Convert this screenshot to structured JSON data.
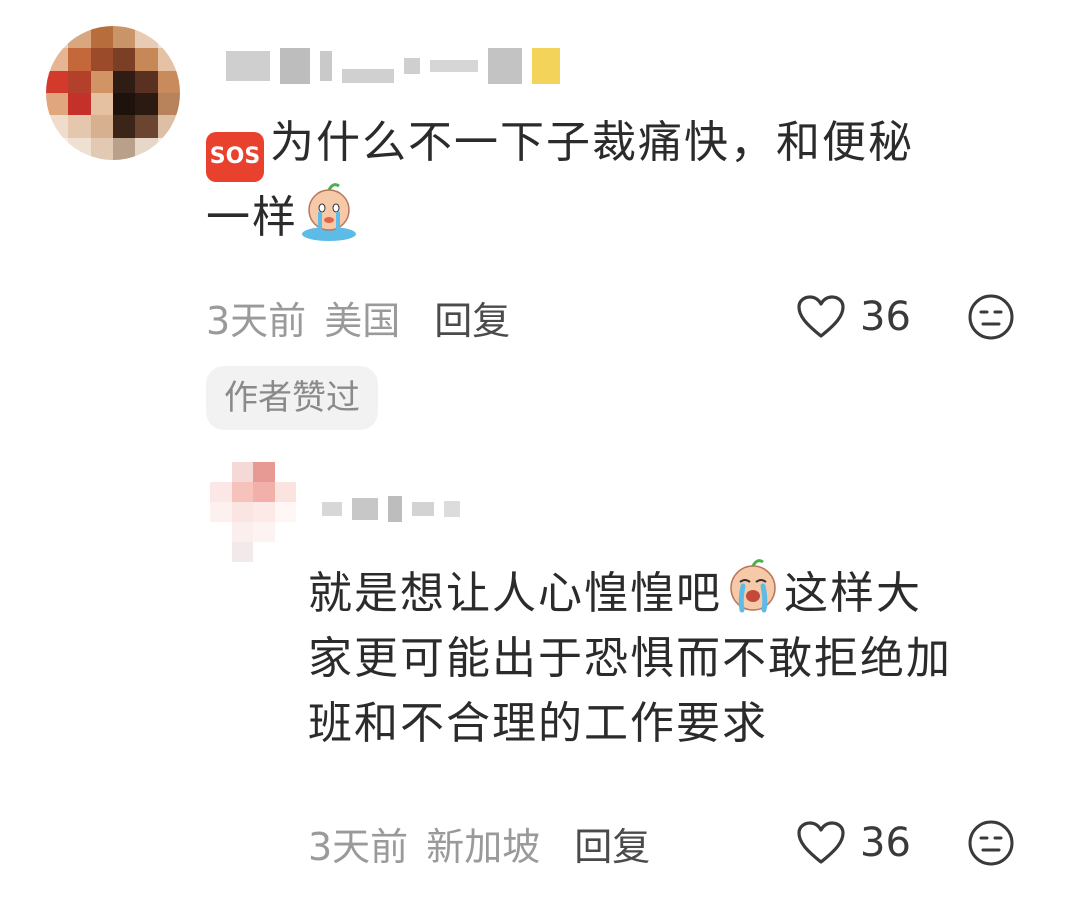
{
  "comments": [
    {
      "text_line1": "为什么不一下子裁痛快，和便秘",
      "text_line2": "一样",
      "time": "3天前",
      "region": "美国",
      "reply_label": "回复",
      "likes": "36",
      "badge": "作者赞过",
      "sos_label": "SOS",
      "emoji": "crying-face-emoji"
    },
    {
      "text_line1a": "就是想让人心惶惶吧",
      "text_line1b": "这样大",
      "text_line2": "家更可能出于恐惧而不敢拒绝加",
      "text_line3": "班和不合理的工作要求",
      "time": "3天前",
      "region": "新加坡",
      "reply_label": "回复",
      "likes": "36",
      "emoji": "sobbing-face-emoji"
    }
  ],
  "icons": {
    "like": "heart-outline-icon",
    "dislike": "meh-face-icon"
  },
  "colors": {
    "sos": "#e8412e",
    "meta_text": "#9a9a9a",
    "body_text": "#2b2b2b"
  }
}
